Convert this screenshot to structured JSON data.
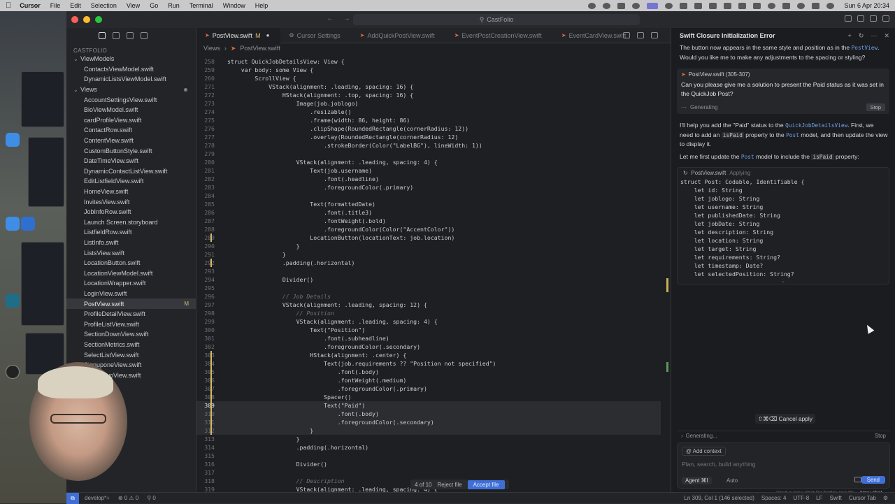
{
  "menubar": {
    "app": "Cursor",
    "items": [
      "File",
      "Edit",
      "Selection",
      "View",
      "Go",
      "Run",
      "Terminal",
      "Window",
      "Help"
    ],
    "clock": "Sun 6 Apr  20:34"
  },
  "window": {
    "search_label": "CastFolio"
  },
  "sidebar": {
    "root": "CASTFOLIO",
    "rows": [
      {
        "label": "ViewModels",
        "type": "folder"
      },
      {
        "label": "ContactsViewModel.swift",
        "type": "file"
      },
      {
        "label": "DynamicListsViewModel.swift",
        "type": "file"
      },
      {
        "label": "Views",
        "type": "folder"
      },
      {
        "label": "AccountSettingsView.swift",
        "type": "file"
      },
      {
        "label": "BioViewModel.swift",
        "type": "file"
      },
      {
        "label": "cardProfileView.swift",
        "type": "file"
      },
      {
        "label": "ContactRow.swift",
        "type": "file"
      },
      {
        "label": "ContentView.swift",
        "type": "file"
      },
      {
        "label": "CustomButtonStyle.swift",
        "type": "file"
      },
      {
        "label": "DateTimeView.swift",
        "type": "file"
      },
      {
        "label": "DynamicContactListView.swift",
        "type": "file"
      },
      {
        "label": "EditListfieldView.swift",
        "type": "file"
      },
      {
        "label": "HomeView.swift",
        "type": "file"
      },
      {
        "label": "InvitesView.swift",
        "type": "file"
      },
      {
        "label": "JobInfoRow.swift",
        "type": "file"
      },
      {
        "label": "Launch Screen.storyboard",
        "type": "file"
      },
      {
        "label": "ListfieldRow.swift",
        "type": "file"
      },
      {
        "label": "ListInfo.swift",
        "type": "file"
      },
      {
        "label": "ListsView.swift",
        "type": "file"
      },
      {
        "label": "LocationButton.swift",
        "type": "file"
      },
      {
        "label": "LocationViewModel.swift",
        "type": "file"
      },
      {
        "label": "LocationWrapper.swift",
        "type": "file"
      },
      {
        "label": "LoginView.swift",
        "type": "file"
      },
      {
        "label": "PostView.swift",
        "type": "file",
        "selected": true,
        "badge": "M"
      },
      {
        "label": "ProfileDetailView.swift",
        "type": "file"
      },
      {
        "label": "ProfileListView.swift",
        "type": "file"
      },
      {
        "label": "SectionDownView.swift",
        "type": "file"
      },
      {
        "label": "SectionMetrics.swift",
        "type": "file"
      },
      {
        "label": "SelectListView.swift",
        "type": "file"
      },
      {
        "label": "SignuponeView.swift",
        "type": "file"
      },
      {
        "label": "SignuptwoView.swift",
        "type": "file"
      },
      {
        "label": "...view.swift",
        "type": "file"
      },
      {
        "label": "...View.swift",
        "type": "file"
      },
      {
        "label": "...k.swift",
        "type": "file"
      },
      {
        "label": ".swift",
        "type": "file"
      },
      {
        "label": "f",
        "type": "file"
      },
      {
        "label": "Widget.swift",
        "type": "file"
      }
    ]
  },
  "editor": {
    "tabs": [
      {
        "label": "PostView.swift",
        "modified": "M",
        "active": true
      },
      {
        "label": "Cursor Settings"
      },
      {
        "label": "AddQuickPostView.swift"
      },
      {
        "label": "EventPostCreationView.swift"
      },
      {
        "label": "EventCardView.swift"
      }
    ],
    "breadcrumbs": [
      "Views",
      "PostView.swift"
    ],
    "lines": [
      {
        "n": "258",
        "t": "struct QuickJobDetailsView: View {"
      },
      {
        "n": "259",
        "t": "    var body: some View {"
      },
      {
        "n": "260",
        "t": "        ScrollView {"
      },
      {
        "n": "271",
        "t": "            VStack(alignment: .leading, spacing: 16) {"
      },
      {
        "n": "272",
        "t": "                HStack(alignment: .top, spacing: 16) {"
      },
      {
        "n": "273",
        "t": "                    Image(job.joblogo)"
      },
      {
        "n": "274",
        "t": "                        .resizable()"
      },
      {
        "n": "275",
        "t": "                        .frame(width: 86, height: 86)"
      },
      {
        "n": "276",
        "t": "                        .clipShape(RoundedRectangle(cornerRadius: 12))"
      },
      {
        "n": "277",
        "t": "                        .overlay(RoundedRectangle(cornerRadius: 12)"
      },
      {
        "n": "278",
        "t": "                            .strokeBorder(Color(\"LabelBG\"), lineWidth: 1))"
      },
      {
        "n": "279",
        "t": ""
      },
      {
        "n": "280",
        "t": "                    VStack(alignment: .leading, spacing: 4) {"
      },
      {
        "n": "281",
        "t": "                        Text(job.username)"
      },
      {
        "n": "282",
        "t": "                            .font(.headline)"
      },
      {
        "n": "283",
        "t": "                            .foregroundColor(.primary)"
      },
      {
        "n": "284",
        "t": ""
      },
      {
        "n": "285",
        "t": "                        Text(formattedDate)"
      },
      {
        "n": "286",
        "t": "                            .font(.title3)"
      },
      {
        "n": "287",
        "t": "                            .fontWeight(.bold)"
      },
      {
        "n": "288",
        "t": "                            .foregroundColor(Color(\"AccentColor\"))"
      },
      {
        "n": "289",
        "t": "                        LocationButton(locationText: job.location)"
      },
      {
        "n": "290",
        "t": "                    }"
      },
      {
        "n": "291",
        "t": "                }"
      },
      {
        "n": "292",
        "t": "                .padding(.horizontal)"
      },
      {
        "n": "293",
        "t": ""
      },
      {
        "n": "294",
        "t": "                Divider()"
      },
      {
        "n": "295",
        "t": ""
      },
      {
        "n": "296",
        "t": "                // Job Details"
      },
      {
        "n": "297",
        "t": "                VStack(alignment: .leading, spacing: 12) {"
      },
      {
        "n": "298",
        "t": "                    // Position"
      },
      {
        "n": "299",
        "t": "                    VStack(alignment: .leading, spacing: 4) {"
      },
      {
        "n": "300",
        "t": "                        Text(\"Position\")"
      },
      {
        "n": "301",
        "t": "                            .font(.subheadline)"
      },
      {
        "n": "302",
        "t": "                            .foregroundColor(.secondary)"
      },
      {
        "n": "303",
        "t": "                        HStack(alignment: .center) {"
      },
      {
        "n": "304",
        "t": "                            Text(job.requirements ?? \"Position not specified\")"
      },
      {
        "n": "305",
        "t": "                                .font(.body)"
      },
      {
        "n": "306",
        "t": "                                .fontWeight(.medium)"
      },
      {
        "n": "307",
        "t": "                                .foregroundColor(.primary)"
      },
      {
        "n": "308",
        "t": "                            Spacer()"
      },
      {
        "n": "309",
        "t": "                            Text(\"Paid\")"
      },
      {
        "n": "310",
        "t": "                                .font(.body)"
      },
      {
        "n": "311",
        "t": "                                .foregroundColor(.secondary)"
      },
      {
        "n": "312",
        "t": "                        }"
      },
      {
        "n": "313",
        "t": "                    }"
      },
      {
        "n": "314",
        "t": "                    .padding(.horizontal)"
      },
      {
        "n": "315",
        "t": ""
      },
      {
        "n": "316",
        "t": "                    Divider()"
      },
      {
        "n": "317",
        "t": ""
      },
      {
        "n": "318",
        "t": "                    // Description"
      },
      {
        "n": "319",
        "t": "                    VStack(alignment: .leading, spacing: 4) {"
      }
    ],
    "diff_bar": {
      "counter": "4 of 10",
      "reject": "Reject file",
      "accept": "Accept file"
    }
  },
  "chat": {
    "title": "Swift Closure Initialization Error",
    "intro_a": "The button now appears in the same style and position as in the ",
    "intro_code": "PostView",
    "intro_b": ". Would you like me to make any adjustments to the spacing or styling?",
    "user_ref": "PostView.swift (305-307)",
    "user_question": "Can you please give me a solution to present the Paid status as it was set in the QuickJob Post?",
    "generating": "Generating",
    "stop": "Stop",
    "reply1_a": "I'll help you add the \"Paid\" status to the ",
    "reply1_code1": "QuickJobDetailsView",
    "reply1_b": ". First, we need to add an ",
    "reply1_code2": "isPaid",
    "reply1_c": " property to the ",
    "reply1_code3": "Post",
    "reply1_d": " model, and then update the view to display it.",
    "reply2_a": "Let me first update the ",
    "reply2_code1": "Post",
    "reply2_b": " model to include the ",
    "reply2_code2": "isPaid",
    "reply2_c": " property:",
    "code_card": {
      "file": "PostView.swift",
      "status": "Applying",
      "lines": [
        "struct Post: Codable, Identifiable {",
        "    let id: String",
        "    let joblogo: String",
        "    let username: String",
        "    let publishedDate: String",
        "    let jobDate: String",
        "    let description: String",
        "    let location: String",
        "    let target: String",
        "    let requirements: String?",
        "    let timestamp: Date?",
        "    let selectedPosition: String?"
      ]
    },
    "cancel_apply": "⇧⌘⌫ Cancel apply",
    "gen_row": "Generating...",
    "gen_stop": "Stop",
    "add_context": "Add context",
    "placeholder": "Plan, search, build anything",
    "agent": "Agent ⌘I",
    "auto": "Auto",
    "send": "Send",
    "hint": "Start a new chat for better results.",
    "new_chat": "New chat"
  },
  "status": {
    "branch": "develop*+",
    "errors": "⊗ 0 ⚠ 0",
    "ports": "⚲ 0",
    "position": "Ln 309, Col 1 (146 selected)",
    "spaces": "Spaces: 4",
    "encoding": "UTF-8",
    "eol": "LF",
    "language": "Swift",
    "tab": "Cursor Tab"
  },
  "colors": {
    "accent": "#3f6fd6",
    "modified": "#d4b86a",
    "swift": "#e26b3b"
  }
}
